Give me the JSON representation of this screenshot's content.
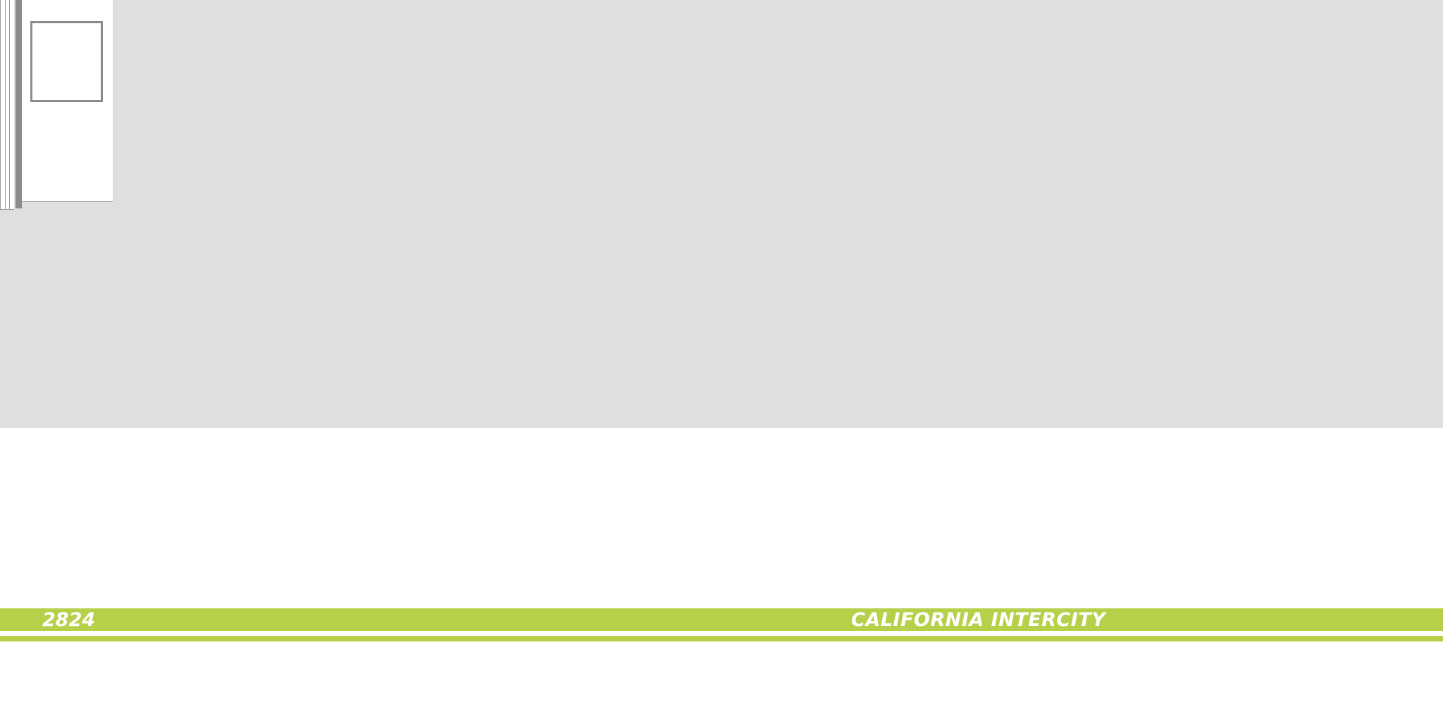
{
  "livery": {
    "car_number": "2824",
    "brand_name": "CALIFORNIA INTERCITY",
    "stripe_color": "#b7d04a",
    "body_color": "#dfdfdf",
    "lower_body_color": "#ffffff"
  },
  "door": {
    "frame_color": "#8b8b8b",
    "window_icon": "square-window-outline"
  }
}
